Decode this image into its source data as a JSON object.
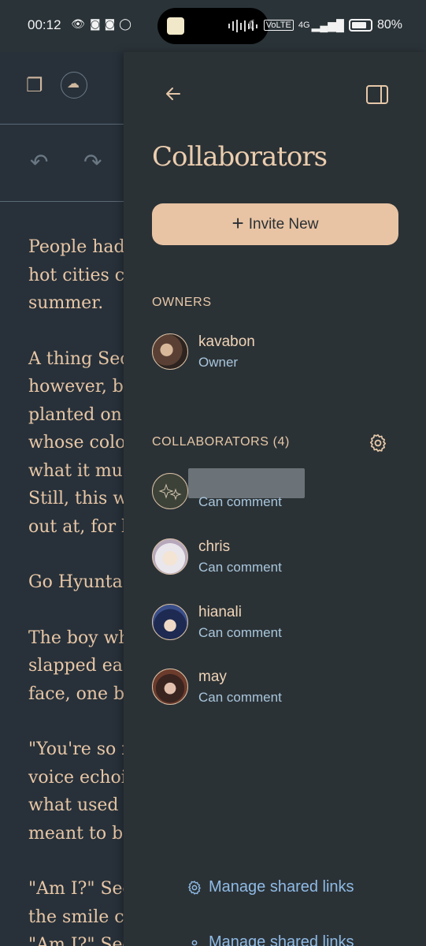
{
  "status_bar": {
    "time": "00:12",
    "battery": "80%",
    "network": "4G",
    "volte": "VoLTE"
  },
  "editor": {
    "paragraphs": [
      [
        "People had",
        "hot cities c",
        "summer."
      ],
      [
        "A thing Sec",
        "however, b",
        "planted on",
        "whose colo",
        "what it mu",
        "Still, this w",
        "out at, for b"
      ],
      [
        "Go Hyunta"
      ],
      [
        "The boy wh",
        "slapped eac",
        "face, one by"
      ],
      [
        "\"You're so f",
        "voice echoi",
        "what used t",
        "meant to be"
      ],
      [
        "\"Am I?\" Sec",
        "the smile c",
        "\"Am I?\" Sec"
      ]
    ]
  },
  "panel": {
    "title": "Collaborators",
    "invite_label": "Invite New",
    "owners_label": "OWNERS",
    "owners": [
      {
        "name": "kavabon",
        "role": "Owner"
      }
    ],
    "collaborators_label": "COLLABORATORS (4)",
    "collaborators": [
      {
        "name": "",
        "role": "Can comment",
        "redacted": true
      },
      {
        "name": "chris",
        "role": "Can comment"
      },
      {
        "name": "hianali",
        "role": "Can comment"
      },
      {
        "name": "may",
        "role": "Can comment"
      }
    ],
    "manage_links_label": "Manage shared links"
  },
  "colors": {
    "panel_bg": "#2b3236",
    "accent": "#e8c4a4",
    "link": "#8fbbe6",
    "role": "#a9c6dc"
  }
}
